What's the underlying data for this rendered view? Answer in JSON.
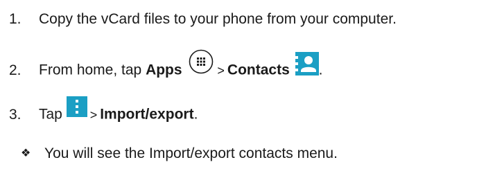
{
  "steps": [
    {
      "number": "1.",
      "text": "Copy the vCard files to your phone from your computer."
    },
    {
      "number": "2.",
      "prefix": "From home, tap ",
      "apps_label": "Apps",
      "separator": ">",
      "contacts_label": "Contacts",
      "suffix": "."
    },
    {
      "number": "3.",
      "prefix": "Tap ",
      "separator": ">",
      "import_label": "Import/export",
      "suffix": "."
    }
  ],
  "note": {
    "bullet": "❖",
    "text": "You will see the Import/export contacts menu."
  },
  "icons": {
    "apps": "apps-grid-icon",
    "contacts": "contacts-person-icon",
    "menu": "menu-dots-icon",
    "accent": "#1b9fc4"
  }
}
